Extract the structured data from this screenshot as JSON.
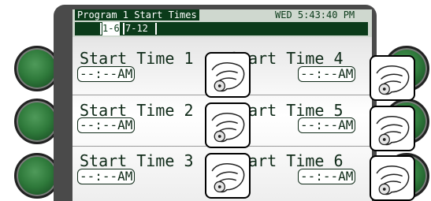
{
  "header": {
    "title": "Program 1 Start Times",
    "clock": "WED 5:43:40 PM"
  },
  "tabs": [
    {
      "label": "1-6",
      "active": true
    },
    {
      "label": "7-12",
      "active": false
    }
  ],
  "start_times": [
    {
      "label": "Start Time 1",
      "value": "--:--AM"
    },
    {
      "label": "Start Time 2",
      "value": "--:--AM"
    },
    {
      "label": "Start Time 3",
      "value": "--:--AM"
    },
    {
      "label": "Start Time 4",
      "value": "--:--AM"
    },
    {
      "label": "Start Time 5",
      "value": "--:--AM"
    },
    {
      "label": "Start Time 6",
      "value": "--:--AM"
    }
  ],
  "icons": {
    "side_button": "round-green-button",
    "touch_hint": "hand-pointing-icon"
  },
  "colors": {
    "accent_dark_green": "#0b3b1a",
    "button_green": "#2f7a3b",
    "frame": "#4a4a4a"
  }
}
